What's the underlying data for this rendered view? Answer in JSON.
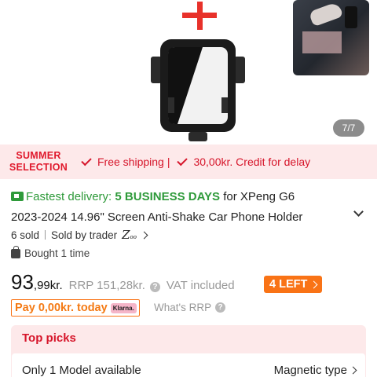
{
  "gallery": {
    "counter": "7/7"
  },
  "banner": {
    "season_line1": "SUMMER",
    "season_line2": "SELECTION",
    "perk_shipping": "Free shipping",
    "perk_credit": "30,00kr. Credit for delay",
    "accent_color": "#d6152a"
  },
  "product": {
    "delivery_prefix": "Fastest delivery:",
    "delivery_days": "5 BUSINESS DAYS",
    "title_line1": "for XPeng G6",
    "title_line2": "2023-2024 14.96\" Screen Anti-Shake Car Phone Holder",
    "sold": "6 sold",
    "sold_by": "Sold by trader",
    "bought": "Bought 1 time"
  },
  "price": {
    "integer": "93",
    "decimal": ",99kr.",
    "rrp": "RRP 151,28kr.",
    "vat": "VAT included",
    "stock_badge": "4 LEFT",
    "pay_today": "Pay 0,00kr. today",
    "klarna": "Klarna.",
    "whats_rrp": "What's RRP"
  },
  "top_picks": {
    "title": "Top picks",
    "option_left": "Only 1 Model available",
    "option_right": "Magnetic type"
  }
}
